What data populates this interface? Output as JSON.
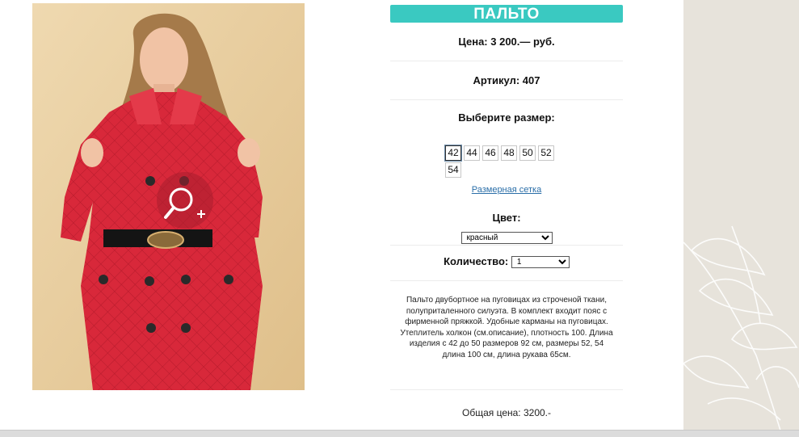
{
  "product": {
    "title": "ПАЛЬТО",
    "price": "Цена: 3 200.— руб.",
    "article": "Артикул: 407",
    "choose_size_label": "Выберите размер:",
    "sizes": [
      "42",
      "44",
      "46",
      "48",
      "50",
      "52",
      "54"
    ],
    "selected_size": "42",
    "size_chart_link": "Размерная сетка",
    "color_label": "Цвет:",
    "color_selected": "красный",
    "quantity_label": "Количество:",
    "quantity_selected": "1",
    "description": "Пальто двубортное на пуговицах из строченой ткани, полуприталенного силуэта. В комплект входит пояс с фирменной пряжкой. Удобные карманы на пуговицах. Утеплитель холкон (см.описание), плотность 100. Длина изделия с 42 до 50 размеров 92 см, размеры 52, 54 длина 100 см, длина рукава 65см.",
    "total": "Общая цена: 3200.-"
  },
  "colors": {
    "accent": "#3ac9c1",
    "link": "#2a6ea8",
    "coat": "#d8283a",
    "side_panel": "#e7e3db"
  },
  "icons": {
    "zoom": "zoom-in-icon"
  }
}
